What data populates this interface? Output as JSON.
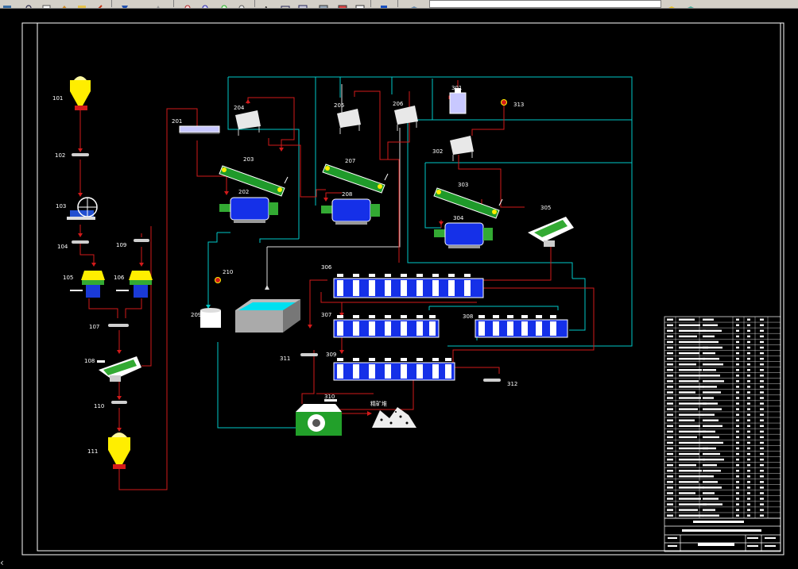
{
  "toolbar": {
    "buttons": [
      "save-icon",
      "zoom-realtime-icon",
      "zoom-window-icon",
      "zoom-prev-icon",
      "properties-icon",
      "match-icon",
      "down-arrow-icon",
      "up-arrow-icon",
      "zoom-in-icon",
      "zoom-out-icon",
      "zoom-all-icon",
      "zoom-extents-icon",
      "text-style-icon",
      "dim-style-icon",
      "table-style-icon",
      "layer-icon",
      "layout-icon",
      "table-icon",
      "help-icon",
      "layer-manager-icon",
      "layer-state-icon"
    ]
  },
  "drawing": {
    "labels": {
      "101": "101",
      "102": "102",
      "103": "103",
      "104": "104",
      "105": "105",
      "106": "106",
      "107": "107",
      "108": "108",
      "109": "109",
      "110": "110",
      "111": "111",
      "201": "201",
      "202": "202",
      "203": "203",
      "204": "204",
      "205": "205",
      "206": "206",
      "207": "207",
      "208": "208",
      "209": "209",
      "210": "210",
      "301": "301",
      "302": "302",
      "303": "303",
      "304": "304",
      "305": "305",
      "306": "306",
      "307": "307",
      "308": "308",
      "309": "309",
      "310": "310",
      "311": "311",
      "312": "312",
      "313": "313"
    },
    "concentrate_label": "精矿堆"
  },
  "colors": {
    "frame": "#ffffff",
    "cyan": "#00c8c8",
    "red": "#d21a1a",
    "yellow": "#ffee00",
    "green": "#229922",
    "blue": "#1030e0",
    "panel": "#d4d0c8"
  }
}
